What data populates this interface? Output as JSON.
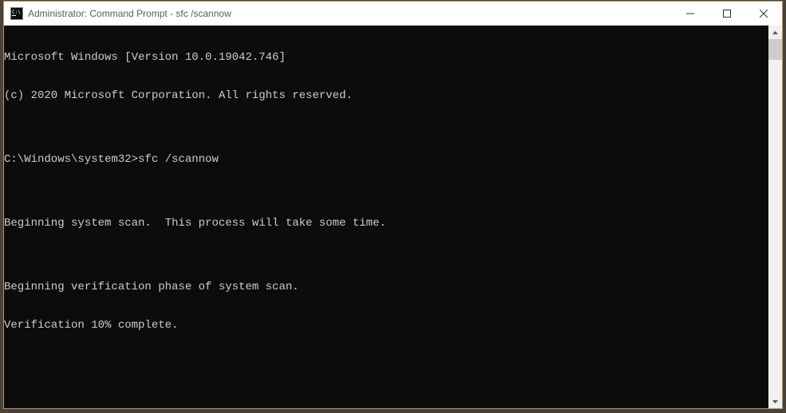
{
  "window": {
    "title": "Administrator: Command Prompt - sfc  /scannow"
  },
  "terminal": {
    "lines": [
      "Microsoft Windows [Version 10.0.19042.746]",
      "(c) 2020 Microsoft Corporation. All rights reserved.",
      "",
      "C:\\Windows\\system32>sfc /scannow",
      "",
      "Beginning system scan.  This process will take some time.",
      "",
      "Beginning verification phase of system scan.",
      "Verification 10% complete."
    ]
  }
}
